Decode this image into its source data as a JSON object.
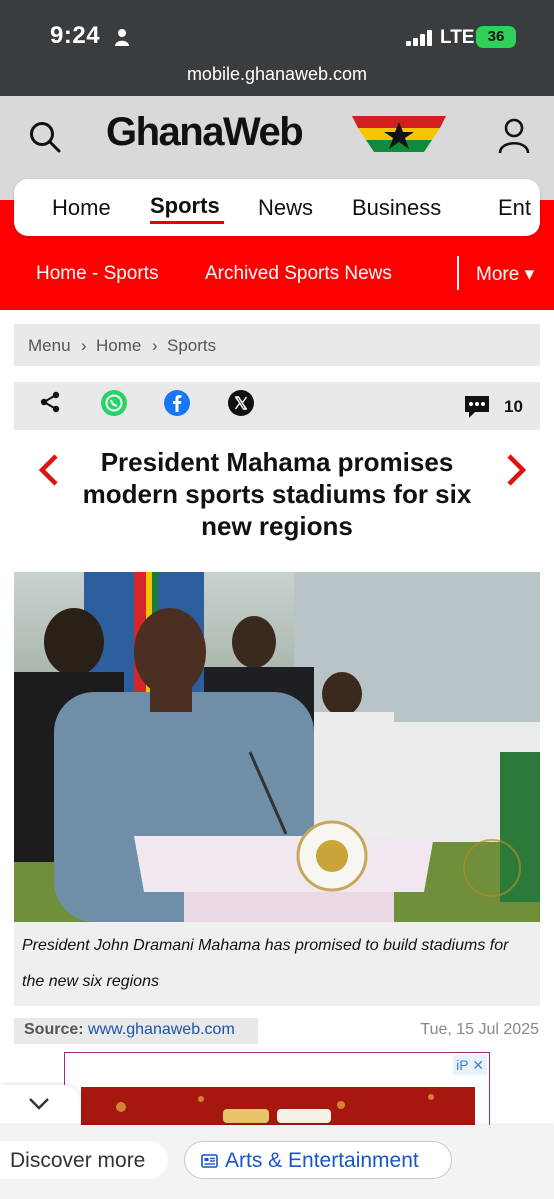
{
  "status_bar": {
    "time": "9:24",
    "carrier": "LTE",
    "battery": "36",
    "url": "mobile.ghanaweb.com"
  },
  "header": {
    "logo": "GhanaWeb"
  },
  "nav": {
    "items": [
      "Home",
      "Sports",
      "News",
      "Business",
      "Ent"
    ],
    "active": "Sports"
  },
  "subnav": {
    "items": [
      "Home - Sports",
      "Archived Sports News"
    ],
    "more": "More ▾"
  },
  "breadcrumb": {
    "menu": "Menu",
    "sep": "›",
    "home": "Home",
    "section": "Sports"
  },
  "share": {
    "comment_count": "10"
  },
  "article": {
    "headline": "President Mahama promises modern sports stadiums for six new regions",
    "caption": "President John Dramani Mahama has promised to build stadiums for the new six regions",
    "source_label": "Source:",
    "source_link": "www.ghanaweb.com",
    "date": "Tue, 15 Jul 2025"
  },
  "ad": {
    "badge": "iP ✕"
  },
  "discover": {
    "label": "Discover more",
    "chip": "Arts & Entertainment"
  },
  "colors": {
    "brand_red": "#ff0000",
    "link_blue": "#1a55a8"
  }
}
